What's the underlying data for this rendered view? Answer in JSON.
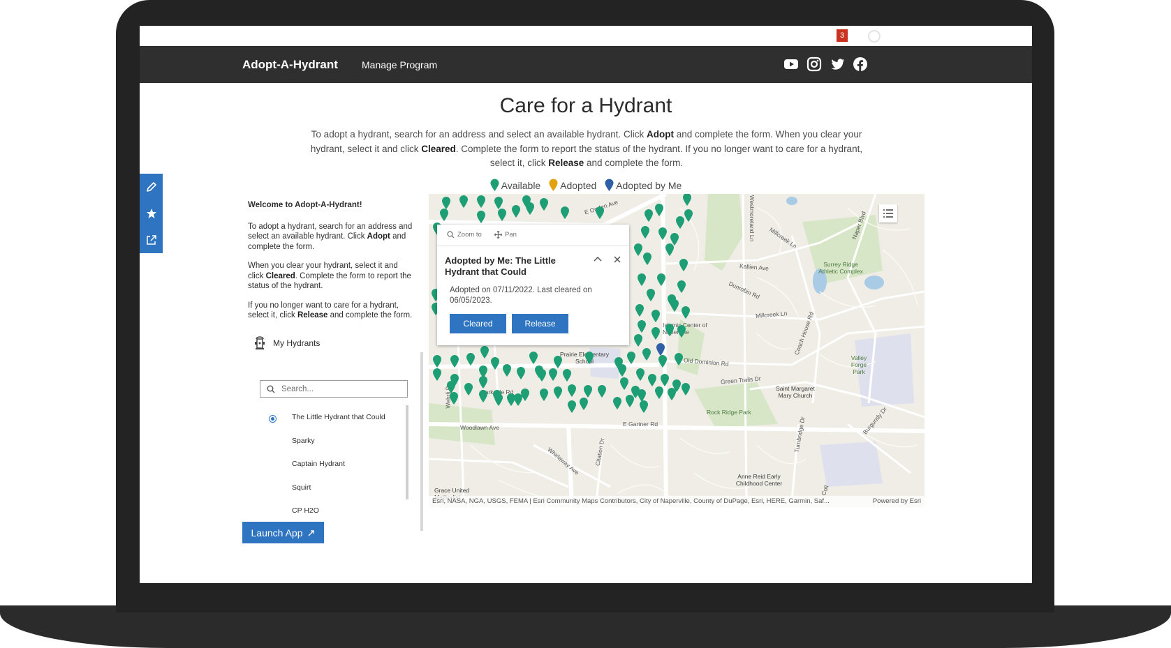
{
  "header": {
    "notification_count": "3"
  },
  "nav": {
    "brand": "Adopt-A-Hydrant",
    "manage_link": "Manage Program"
  },
  "main": {
    "title": "Care for a Hydrant",
    "intro": {
      "t1": "To adopt a hydrant, search for an address and select an available hydrant. Click ",
      "b1": "Adopt",
      "t2": " and complete the form. When you clear your hydrant, select it and click ",
      "b2": "Cleared",
      "t3": ". Complete the form to report the status of the hydrant. If you no longer want to care for a hydrant, select it, click ",
      "b3": "Release",
      "t4": " and complete the form."
    },
    "legend": {
      "available": "Available",
      "adopted": "Adopted",
      "adopted_by_me": "Adopted by Me"
    }
  },
  "colors": {
    "available": "#1e9e74",
    "adopted": "#e2a10f",
    "adopted_by_me": "#2f5fa6",
    "accent": "#2f74c1",
    "navbar": "#2f2f2f"
  },
  "panel": {
    "welcome": "Welcome to Adopt-A-Hydrant!",
    "p1a": "To adopt a hydrant, search for an address and select an available hydrant. Click ",
    "p1b": "Adopt",
    "p1c": " and complete the form.",
    "p2a": "When you clear your hydrant, select it and click ",
    "p2b": "Cleared",
    "p2c": ". Complete the form to report the status of the hydrant.",
    "p3a": "If you no longer want to care for a hydrant, select it, click ",
    "p3b": "Release",
    "p3c": " and complete the form.",
    "my_hydrants": "My Hydrants",
    "search_placeholder": "Search...",
    "hydrants": [
      "The Little Hydrant that Could",
      "Sparky",
      "Captain Hydrant",
      "Squirt",
      "CP H2O"
    ],
    "selected_index": 0
  },
  "launch_button": "Launch App",
  "map": {
    "labels": {
      "l1": "E Ogden Ave",
      "l2": "Westmoreland Ln",
      "l3": "Millcreek Ln",
      "l4": "Naper Blvd",
      "l5": "Surrey Ridge Athletic Complex",
      "l6": "Kallien Ave",
      "l7": "Dunrobin Rd",
      "l8": "Millcreek Ln",
      "l9": "Islamic Center of Naperville",
      "l10": "Coach House Rd",
      "l11": "Prairie Elementary School",
      "l12": "Old Dominion Rd",
      "l13": "Green Trails Dr",
      "l14": "Valley Forge Park",
      "l15": "Saint Margaret Mary Church",
      "l16": "Rock Ridge Park",
      "l17": "E Gartner Rd",
      "l18": "Woodlawn Ave",
      "l19": "Whirlaway Ave",
      "l20": "Citation Dr",
      "l21": "Turnbridge Dr",
      "l22": "Anne Reid Early Childhood Center",
      "l23": "Grace United Methodist",
      "l24": "Parkside Rd",
      "l25": "Wehrli Dr",
      "l26": "Burgundy Dr",
      "l27": "Coll"
    },
    "attribution": "Esri, NASA, NGA, USGS, FEMA | Esri Community Maps Contributors, City of Naperville, County of DuPage, Esri, HERE, Garmin, Saf...",
    "powered_by": "Powered by Esri",
    "popup": {
      "zoom": "Zoom to",
      "pan": "Pan",
      "title": "Adopted by Me: The Little Hydrant that Could",
      "body": "Adopted on 07/11/2022. Last cleared on 06/05/2023.",
      "cleared": "Cleared",
      "release": "Release"
    }
  }
}
